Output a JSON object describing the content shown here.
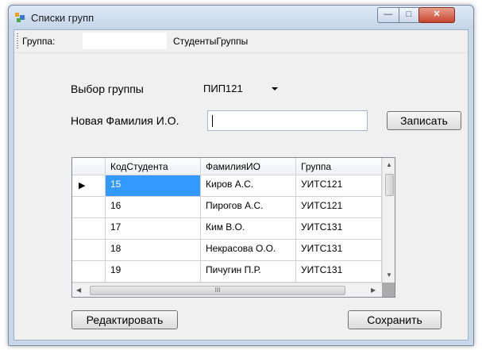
{
  "window": {
    "title": "Списки групп"
  },
  "toolbar": {
    "group_label": "Группа:",
    "group_value": "",
    "students_label": "СтудентыГруппы"
  },
  "form": {
    "group_select_label": "Выбор группы",
    "group_select_value": "ПИП121",
    "new_name_label": "Новая Фамилия И.О.",
    "new_name_value": "",
    "write_button": "Записать"
  },
  "grid": {
    "columns": [
      "КодСтудента",
      "ФамилияИО",
      "Группа"
    ],
    "rows": [
      [
        "15",
        "Киров А.С.",
        "УИТС121"
      ],
      [
        "16",
        "Пирогов А.С.",
        "УИТС121"
      ],
      [
        "17",
        "Ким В.О.",
        "УИТС131"
      ],
      [
        "18",
        "Некрасова О.О.",
        "УИТС131"
      ],
      [
        "19",
        "Пичугин П.Р.",
        "УИТС131"
      ]
    ],
    "current_row_marker": "▶",
    "hscroll_grip": "III"
  },
  "buttons": {
    "edit": "Редактировать",
    "save": "Сохранить"
  },
  "titlebar_buttons": {
    "minimize": "—",
    "maximize": "□",
    "close": "✕"
  },
  "colors": {
    "selection": "#3399ff",
    "window_frame": "#c9d8e8",
    "close_button": "#c5442e"
  }
}
